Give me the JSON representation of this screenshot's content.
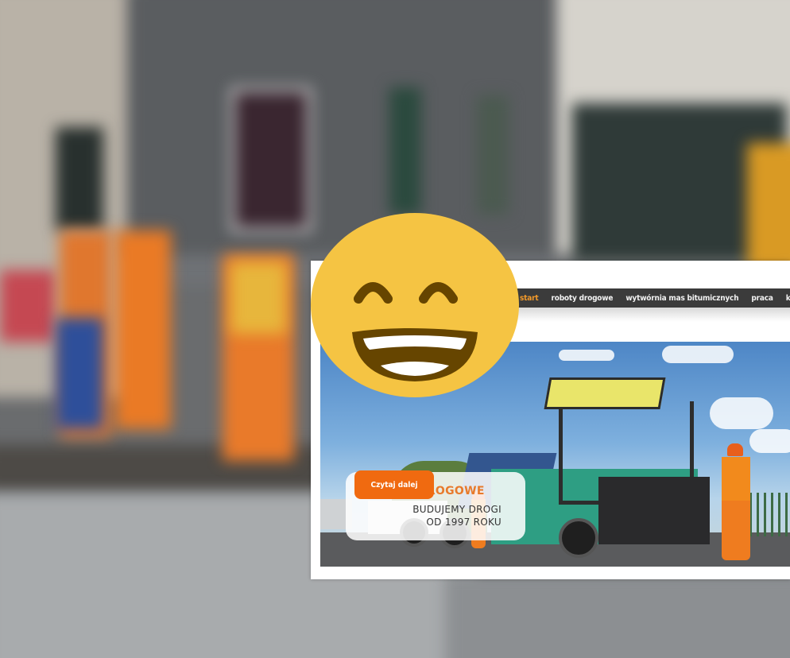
{
  "nav": {
    "items": [
      {
        "label": "start",
        "active": true
      },
      {
        "label": "roboty drogowe",
        "active": false
      },
      {
        "label": "wytwórnia mas bitumicznych",
        "active": false
      },
      {
        "label": "praca",
        "active": false
      },
      {
        "label": "kontakt",
        "active": false
      }
    ]
  },
  "hero": {
    "title": "ROBOTY DROGOWE",
    "subtitle_line1": "BUDUJEMY DROGI",
    "subtitle_line2": "OD 1997 ROKU",
    "cta_label": "Czytaj dalej"
  },
  "colors": {
    "accent": "#f06a10",
    "nav_bg": "#3b3b3b",
    "nav_active": "#f39a2a",
    "emoji_face": "#f5c443",
    "emoji_features": "#664500"
  },
  "emoji": {
    "icon": "grinning-face-with-smiling-eyes-icon"
  }
}
